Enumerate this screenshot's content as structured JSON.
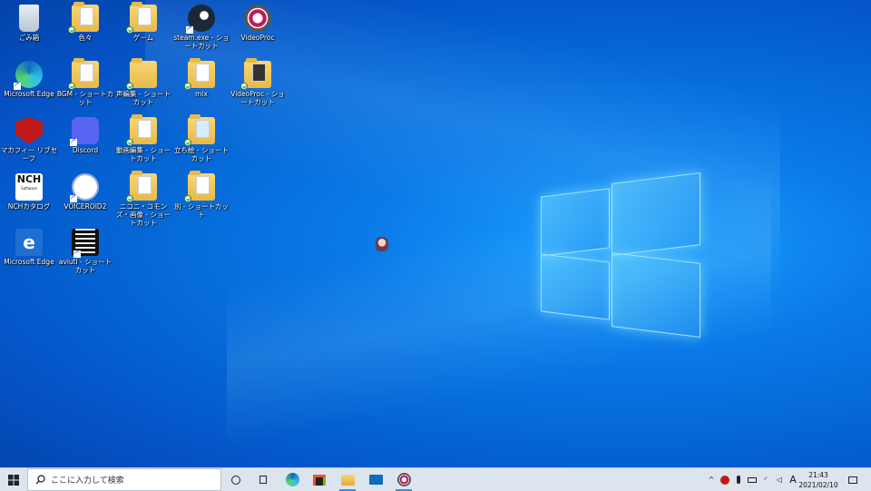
{
  "desktop": {
    "icons": [
      {
        "label": "ごみ箱",
        "icon": "recycle-bin-icon"
      },
      {
        "label": "色々",
        "icon": "folder-icon"
      },
      {
        "label": "ゲーム",
        "icon": "folder-icon"
      },
      {
        "label": "steam.exe - ショートカット",
        "icon": "steam-icon"
      },
      {
        "label": "VideoProc",
        "icon": "videoproc-icon"
      },
      {
        "label": "Microsoft Edge",
        "icon": "edge-icon"
      },
      {
        "label": "BGM - ショートカット",
        "icon": "folder-icon"
      },
      {
        "label": "声編集 - ショートカット",
        "icon": "folder-icon"
      },
      {
        "label": "mix",
        "icon": "folder-icon"
      },
      {
        "label": "VideoProc - ショートカット",
        "icon": "folder-icon"
      },
      {
        "label": "マカフィー リブセーフ",
        "icon": "mcafee-icon"
      },
      {
        "label": "Discord",
        "icon": "discord-icon"
      },
      {
        "label": "動画編集 - ショートカット",
        "icon": "folder-icon"
      },
      {
        "label": "立ち絵 - ショートカット",
        "icon": "folder-icon"
      },
      {
        "label": "NCHカタログ",
        "icon": "nch-icon"
      },
      {
        "label": "VOICEROID2",
        "icon": "voiceroid-icon"
      },
      {
        "label": "ニコニ・コモンズ・画像 - ショートカット",
        "icon": "folder-icon"
      },
      {
        "label": "別 - ショートカット",
        "icon": "folder-icon"
      },
      {
        "label": "Microsoft Edge",
        "icon": "edge-legacy-icon"
      },
      {
        "label": "aviutl - ショートカット",
        "icon": "film-icon"
      }
    ],
    "nch_logo_text": "NCH",
    "nch_logo_sub": "Software"
  },
  "taskbar": {
    "search_placeholder": "ここに入力して検索",
    "ime_indicator": "A",
    "clock_time": "21:43",
    "clock_date": "2021/02/10",
    "pinned": [
      "cortana-icon",
      "task-view-icon",
      "edge-icon",
      "store-icon",
      "file-explorer-icon",
      "mail-icon",
      "videoproc-icon"
    ]
  },
  "colors": {
    "wallpaper": "#0567d6",
    "taskbar": "#dce4ee",
    "accent": "#3b8fde"
  }
}
